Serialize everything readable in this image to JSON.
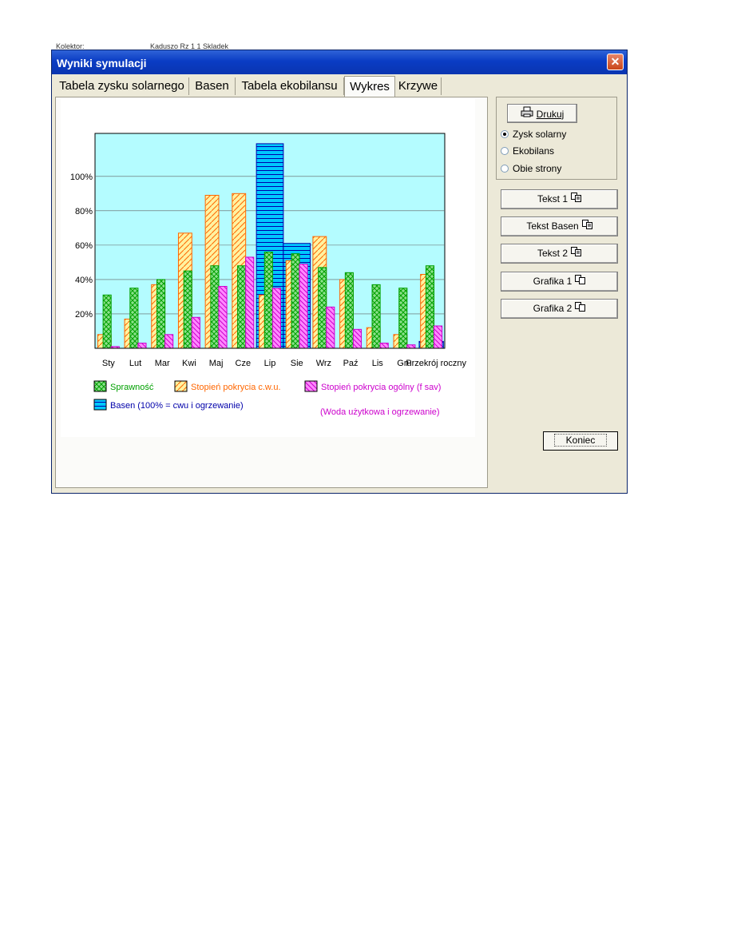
{
  "background_text": [
    "Kolektor:",
    "Kaduszo Rz 1 1 Skladek"
  ],
  "window": {
    "title": "Wyniki symulacji",
    "close_symbol": "✕"
  },
  "tabs": [
    {
      "label": "Tabela zysku solarnego",
      "active": false
    },
    {
      "label": "Basen",
      "active": false
    },
    {
      "label": "Tabela ekobilansu",
      "active": false
    },
    {
      "label": "Wykres",
      "active": true
    },
    {
      "label": "Krzywe",
      "active": false
    }
  ],
  "print_button": {
    "label": "Drukuj",
    "icon": "printer-icon"
  },
  "radio_options": [
    {
      "label": "Zysk solarny",
      "selected": true
    },
    {
      "label": "Ekobilans",
      "selected": false
    },
    {
      "label": "Obie strony",
      "selected": false
    }
  ],
  "copy_buttons": [
    {
      "label": "Tekst 1",
      "icon": "copy-text-icon"
    },
    {
      "label": "Tekst Basen",
      "icon": "copy-text-icon"
    },
    {
      "label": "Tekst 2",
      "icon": "copy-text-icon"
    },
    {
      "label": "Grafika 1",
      "icon": "copy-graphic-icon"
    },
    {
      "label": "Grafika 2",
      "icon": "copy-graphic-icon"
    }
  ],
  "close_button": {
    "label": "Koniec"
  },
  "chart_data": {
    "type": "bar",
    "title": "",
    "xlabel": "",
    "ylabel": "",
    "ylim": [
      0,
      125
    ],
    "yticks": [
      20,
      40,
      60,
      80,
      100
    ],
    "ytick_labels": [
      "20%",
      "40%",
      "60%",
      "80%",
      "100%"
    ],
    "grid": true,
    "legend_placement": "bottom",
    "categories": [
      "Sty",
      "Lut",
      "Mar",
      "Kwi",
      "Maj",
      "Cze",
      "Lip",
      "Sie",
      "Wrz",
      "Paź",
      "Lis",
      "Gru",
      "Przekrój roczny"
    ],
    "series": [
      {
        "name": "Sprawność",
        "color": "#00a000",
        "fill": "#8be08b",
        "pattern": "crosshatch",
        "values": [
          31,
          35,
          40,
          45,
          48,
          48,
          56,
          55,
          47,
          44,
          37,
          35,
          48
        ]
      },
      {
        "name": "Stopień pokrycia c.w.u.",
        "color": "#ff6600",
        "fill": "#fff2a0",
        "pattern": "diagonal",
        "values": [
          8,
          17,
          37,
          67,
          89,
          90,
          31,
          51,
          65,
          40,
          12,
          8,
          43
        ]
      },
      {
        "name": "Stopień pokrycia ogólny (f sav)",
        "color": "#cc00cc",
        "fill": "#ff88ff",
        "pattern": "diagonal",
        "values": [
          1,
          3,
          8,
          18,
          36,
          53,
          35,
          49,
          24,
          11,
          3,
          2,
          13
        ]
      },
      {
        "name": "Basen (100% = cwu i ogrzewanie)",
        "color": "#0000aa",
        "fill": "#00c8ff",
        "pattern": "horizontal",
        "values": [
          0,
          0,
          0,
          0,
          0,
          0,
          119,
          61,
          0,
          0,
          0,
          0,
          4
        ]
      }
    ],
    "legend_note": "(Woda użytkowa i ogrzewanie)",
    "plot_background": "#b4fcff"
  }
}
